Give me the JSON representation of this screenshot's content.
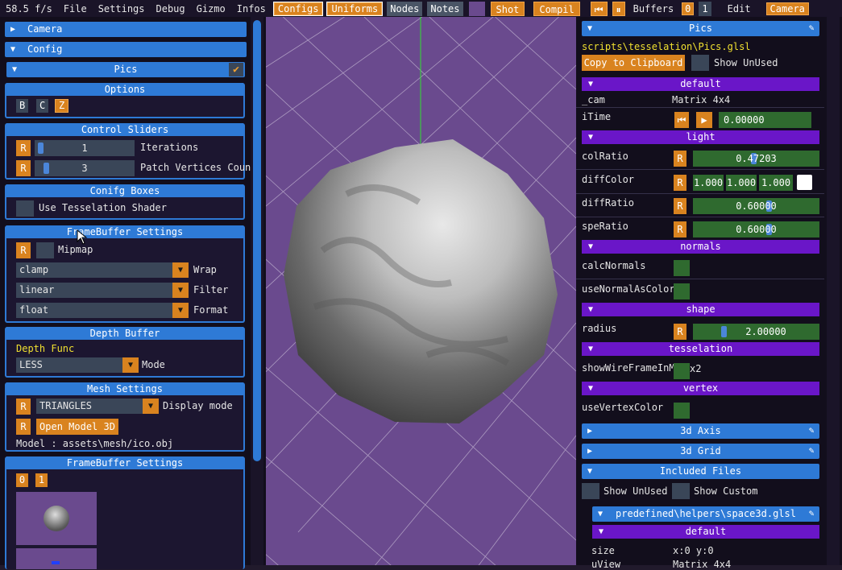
{
  "menubar": {
    "fps": "58.5 f/s",
    "file": "File",
    "settings": "Settings",
    "debug": "Debug",
    "gizmo": "Gizmo",
    "infos": "Infos",
    "configs": "Configs",
    "uniforms": "Uniforms",
    "nodes": "Nodes",
    "notes": "Notes",
    "shot": "Shot",
    "compil": "Compil",
    "buffers": "Buffers",
    "buf0": "0",
    "buf1": "1",
    "edit": "Edit",
    "camera": "Camera"
  },
  "left": {
    "camera": "Camera",
    "config": "Config",
    "pics": "Pics",
    "options": {
      "title": "Options",
      "b": "B",
      "c": "C",
      "z": "Z"
    },
    "control_sliders": {
      "title": "Control Sliders",
      "reset": "R",
      "iterations_value": "1",
      "iterations_label": "Iterations",
      "patch_value": "3",
      "patch_label": "Patch Vertices Coun",
      "iterations_fraction": 0.02,
      "patch_fraction": 0.08
    },
    "config_boxes": {
      "title": "Conifg Boxes",
      "tess_label": "Use Tesselation Shader"
    },
    "fb_settings": {
      "title": "FrameBuffer Settings",
      "reset": "R",
      "mipmap": "Mipmap",
      "wrap_value": "clamp",
      "wrap_label": "Wrap",
      "filter_value": "linear",
      "filter_label": "Filter",
      "format_value": "float",
      "format_label": "Format"
    },
    "depth": {
      "title": "Depth Buffer",
      "func": "Depth Func",
      "mode_value": "LESS",
      "mode_label": "Mode"
    },
    "mesh": {
      "title": "Mesh Settings",
      "reset": "R",
      "display_value": "TRIANGLES",
      "display_label": "Display mode",
      "open_model": "Open Model 3D",
      "model": "Model : assets\\mesh/ico.obj"
    },
    "fb2": {
      "title": "FrameBuffer Settings",
      "b0": "0",
      "b1": "1"
    }
  },
  "right": {
    "pics": "Pics",
    "path": "scripts\\tesselation\\Pics.glsl",
    "copy": "Copy to Clipboard",
    "show_unused": "Show UnUsed",
    "default": "default",
    "cam_label": "_cam",
    "cam_value": "Matrix 4x4",
    "itime_label": "iTime",
    "itime_value": "0.00000",
    "light": "light",
    "reset": "R",
    "colratio_label": "colRatio",
    "colratio_value": "0.47203",
    "colratio_fraction": 0.47,
    "diffcolor_label": "diffColor",
    "diff_r": "1.000",
    "diff_g": "1.000",
    "diff_b": "1.000",
    "diff_swatch": "#ffffff",
    "diffratio_label": "diffRatio",
    "diffratio_value": "0.60000",
    "diffratio_fraction": 0.6,
    "speratio_label": "speRatio",
    "speratio_value": "0.60000",
    "speratio_fraction": 0.6,
    "normals": "normals",
    "calcnormals_label": "calcNormals",
    "usenormal_label": "useNormalAsColor",
    "shape": "shape",
    "radius_label": "radius",
    "radius_value": "2.00000",
    "radius_fraction": 0.22,
    "tesselation": "tesselation",
    "wireframe_label": "showWireFrameInM",
    "wireframe_suffix": "x2",
    "vertex": "vertex",
    "usevertex_label": "useVertexColor",
    "axis": "3d Axis",
    "grid": "3d Grid",
    "included": "Included Files",
    "show_unused2": "Show UnUsed",
    "show_custom": "Show Custom",
    "space3d": "predefined\\helpers\\space3d.glsl",
    "default2": "default",
    "size_label": "size",
    "size_value": "x:0 y:0",
    "uview_label": "uView",
    "uview_value": "Matrix 4x4"
  },
  "colors": {
    "accent_blue": "#2e7ad6",
    "orange": "#d9831f",
    "purple_header": "#6a16c8",
    "viewport": "#6a4a8e",
    "green_field": "#2f6a2f"
  }
}
